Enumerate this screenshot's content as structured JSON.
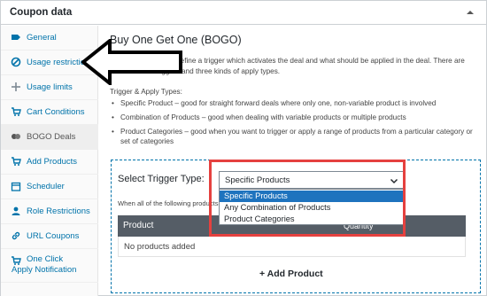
{
  "panel": {
    "title": "Coupon data"
  },
  "sidebar": {
    "items": [
      {
        "label": "General",
        "icon": "ticket-icon"
      },
      {
        "label": "Usage restriction",
        "icon": "restriction-icon"
      },
      {
        "label": "Usage limits",
        "icon": "plus-icon"
      },
      {
        "label": "Cart Conditions",
        "icon": "cart-icon"
      },
      {
        "label": "BOGO Deals",
        "icon": "bogo-icon"
      },
      {
        "label": "Add Products",
        "icon": "cart-icon"
      },
      {
        "label": "Scheduler",
        "icon": "calendar-icon"
      },
      {
        "label": "Role Restrictions",
        "icon": "user-icon"
      },
      {
        "label": "URL Coupons",
        "icon": "link-icon"
      },
      {
        "label": "One Click Apply Notification",
        "icon": "cart-icon"
      }
    ]
  },
  "main": {
    "heading": "Buy One Get One (BOGO)",
    "intro": "BOGO deals let you define a trigger which activates the deal and what should be applied in the deal. There are three kinds of triggers and three kinds of apply types.",
    "types_title": "Trigger & Apply Types:",
    "bullets": [
      "Specific Product – good for straight forward deals where only one, non-variable product is involved",
      "Combination of Products – good when dealing with variable products or multiple products",
      "Product Categories – good when you want to trigger or apply a range of products from a particular category or set of categories"
    ],
    "trigger": {
      "label": "Select Trigger Type:",
      "selected": "Specific Products",
      "options": [
        "Specific Products",
        "Any Combination of Products",
        "Product Categories"
      ]
    },
    "when_text": "When all of the following products",
    "table": {
      "col_product": "Product",
      "col_quantity": "Quantity",
      "empty": "No products added"
    },
    "add_product": "+ Add Product"
  },
  "colors": {
    "accent": "#0073aa",
    "highlight": "#e5413f",
    "selected_option": "#1e73be",
    "table_header": "#555d66"
  }
}
